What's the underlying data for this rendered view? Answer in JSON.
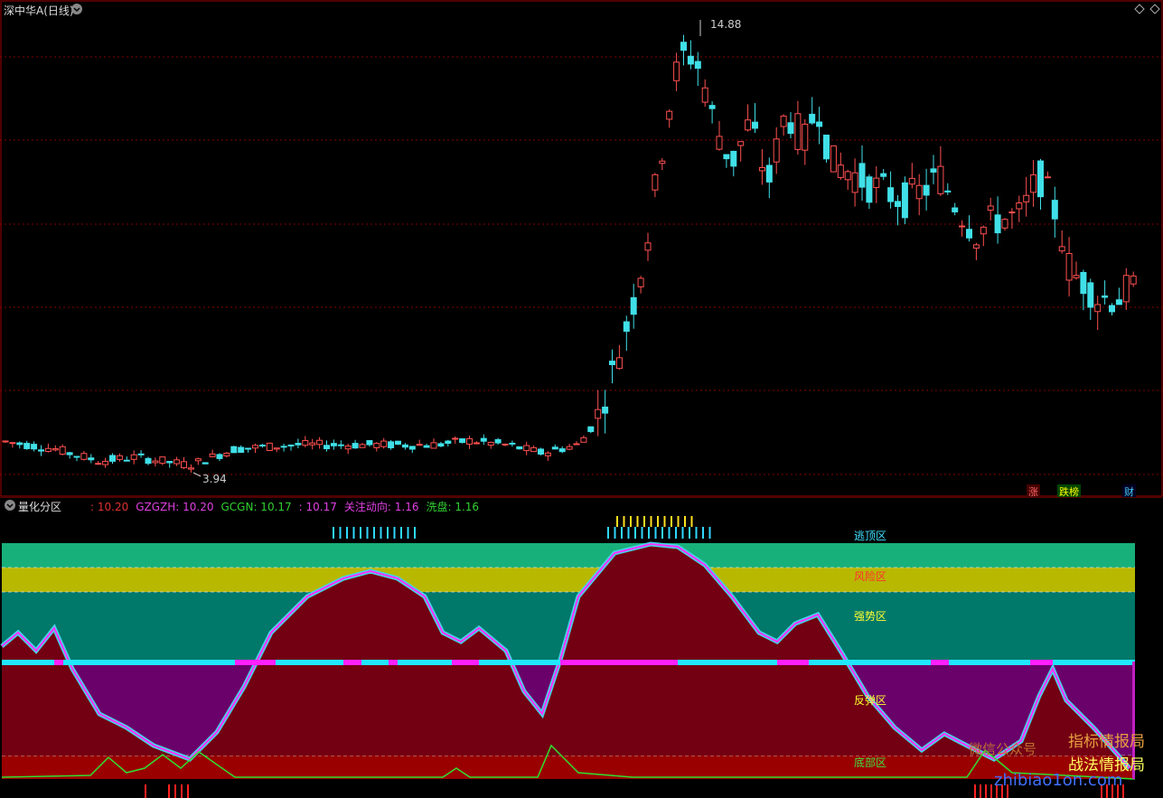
{
  "main_panel": {
    "title": "深中华A(日线)",
    "high_label": "14.88",
    "low_label": "3.94",
    "tags": [
      "涨",
      "跌榜",
      "财"
    ]
  },
  "indicator_panel": {
    "title": "量化分区",
    "values": [
      {
        "text": ": 10.20",
        "color": "#e03030"
      },
      {
        "text": "GZGZH: 10.20",
        "color": "#e040e0"
      },
      {
        "text": "GCGN: 10.17",
        "color": "#30d030"
      },
      {
        "text": ": 10.17",
        "color": "#e040e0"
      },
      {
        "text": "关注动向: 1.16",
        "color": "#e040e0"
      },
      {
        "text": "洗盘: 1.16",
        "color": "#30d030"
      }
    ],
    "zones": [
      {
        "name": "逃顶区",
        "color": "#18b07a",
        "text_color": "#40e0ff"
      },
      {
        "name": "风险区",
        "color": "#b8b800",
        "text_color": "#ff3030"
      },
      {
        "name": "强势区",
        "color": "#00786a",
        "text_color": "#ffff30"
      },
      {
        "name": "反弹区",
        "color": "#6a006a",
        "text_color": "#ffff30"
      },
      {
        "name": "底部区",
        "color": "#9a0000",
        "text_color": "#40e040"
      }
    ],
    "watermark": [
      "微信公众号",
      "指标情报局",
      "战法情报局",
      "zhibiao1on.com"
    ]
  },
  "chart_data": {
    "type": "candlestick",
    "title": "深中华A(日线)",
    "price_high": 14.88,
    "price_low": 3.94,
    "series": [
      {
        "name": "GZGZH",
        "value": 10.2
      },
      {
        "name": "GCGN",
        "value": 10.17
      },
      {
        "name": "关注动向",
        "value": 1.16
      },
      {
        "name": "洗盘",
        "value": 1.16
      }
    ]
  }
}
